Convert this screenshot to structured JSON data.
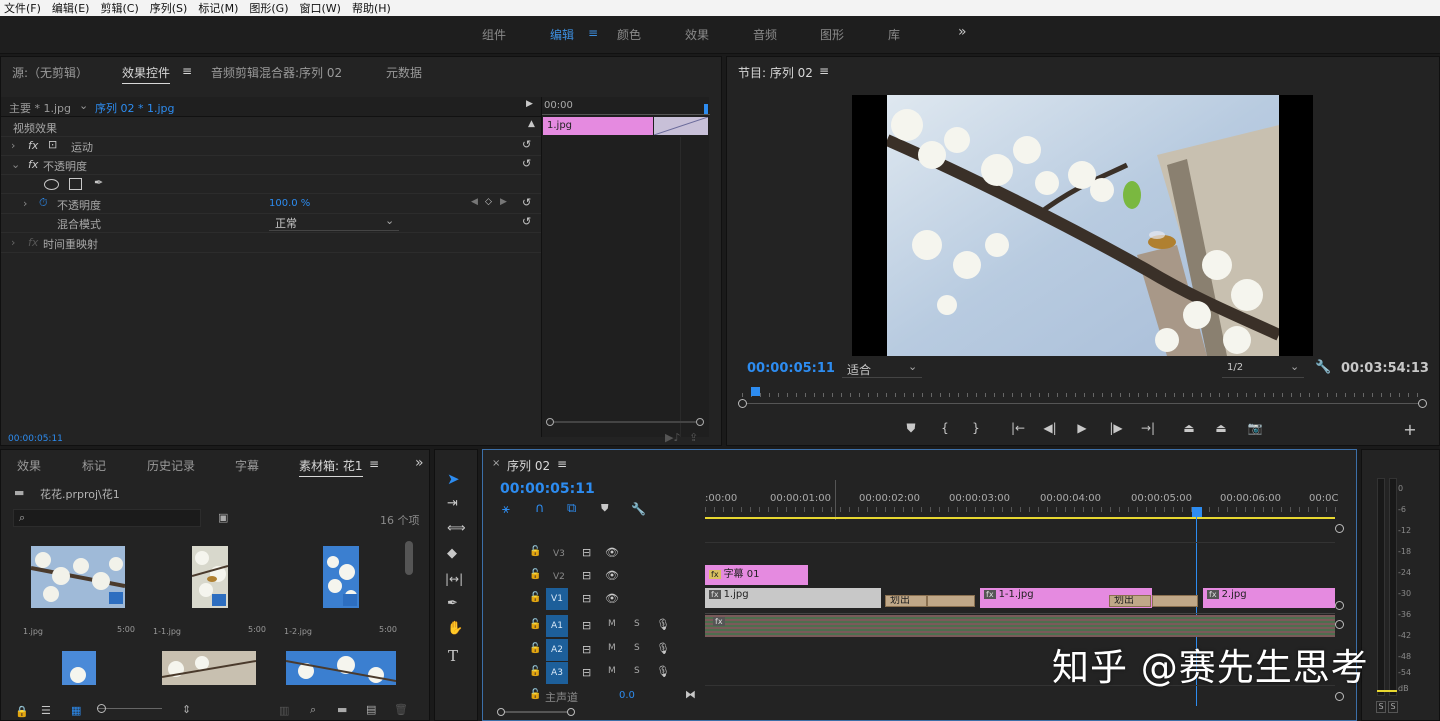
{
  "menu": [
    "文件(F)",
    "编辑(E)",
    "剪辑(C)",
    "序列(S)",
    "标记(M)",
    "图形(G)",
    "窗口(W)",
    "帮助(H)"
  ],
  "workspaces": {
    "items": [
      "组件",
      "编辑",
      "颜色",
      "效果",
      "音频",
      "图形",
      "库"
    ],
    "active": "编辑",
    "overflow": "»"
  },
  "source_panel": {
    "tabs": [
      "源:（无剪辑）",
      "效果控件",
      "音频剪辑混合器:序列 02",
      "元数据"
    ],
    "active_tab": "效果控件",
    "master_label": "主要 * 1.jpg",
    "sequence_clip": "序列 02 * 1.jpg",
    "ruler_time": "00:00",
    "clip_name": "1.jpg",
    "video_effects": "视频效果",
    "motion": "运动",
    "opacity": "不透明度",
    "opacity_prop": "不透明度",
    "opacity_value": "100.0 %",
    "blend_mode": "混合模式",
    "blend_value": "正常",
    "time_remap": "时间重映射",
    "timecode": "00:00:05:11"
  },
  "program_monitor": {
    "title": "节目: 序列 02",
    "timecode": "00:00:05:11",
    "fit": "适合",
    "resolution": "1/2",
    "duration": "00:03:54:13"
  },
  "project_panel": {
    "tabs": [
      "效果",
      "标记",
      "历史记录",
      "字幕",
      "素材箱: 花1"
    ],
    "active_tab": "素材箱: 花1",
    "overflow": "»",
    "path": "花花.prproj\\花1",
    "item_count": "16 个项",
    "items": [
      {
        "name": "1.jpg",
        "dur": "5:00"
      },
      {
        "name": "1-1.jpg",
        "dur": "5:00"
      },
      {
        "name": "1-2.jpg",
        "dur": "5:00"
      }
    ]
  },
  "timeline": {
    "tab": "序列 02",
    "timecode": "00:00:05:11",
    "ruler": [
      ":00:00",
      "00:00:01:00",
      "00:00:02:00",
      "00:00:03:00",
      "00:00:04:00",
      "00:00:05:00",
      "00:00:06:00",
      "00:0C"
    ],
    "tracks": {
      "v3": "V3",
      "v2": "V2",
      "v1": "V1",
      "a1": "A1",
      "a2": "A2",
      "a3": "A3"
    },
    "master": "主声道",
    "master_value": "0.0",
    "clips": {
      "title": "字幕 01",
      "v1a": "1.jpg",
      "v1b": "1-1.jpg",
      "v1c": "2.jpg",
      "trans1": "划出",
      "trans2": "划出"
    }
  },
  "meter_labels": [
    "0",
    "-6",
    "-12",
    "-18",
    "-24",
    "-30",
    "-36",
    "-42",
    "-48",
    "-54",
    "dB"
  ],
  "solo_labels": [
    "S",
    "S"
  ],
  "watermark": "知乎 @赛先生思考",
  "colors": {
    "accent": "#2d8cf0",
    "clip_pink": "#e58ae0",
    "playhead": "#2d8cf0"
  }
}
